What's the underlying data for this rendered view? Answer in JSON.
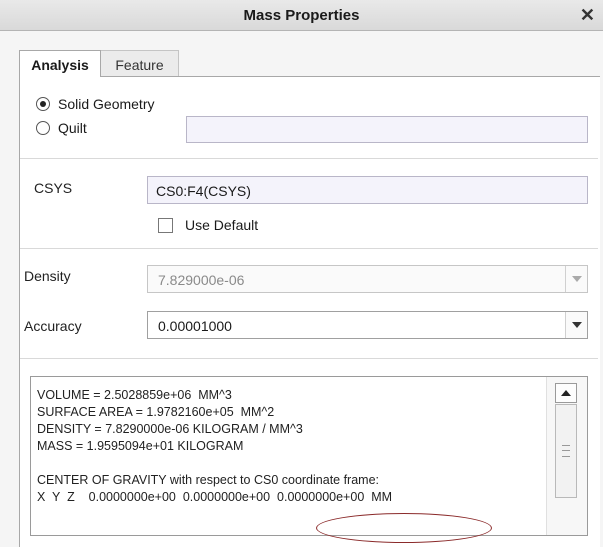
{
  "window": {
    "title": "Mass Properties",
    "close_glyph": "✕"
  },
  "tabs": [
    {
      "label": "Analysis",
      "active": true
    },
    {
      "label": "Feature",
      "active": false
    }
  ],
  "geometry": {
    "options": [
      {
        "label": "Solid Geometry",
        "selected": true
      },
      {
        "label": "Quilt",
        "selected": false
      }
    ],
    "quilt_value": ""
  },
  "csys": {
    "label": "CSYS",
    "value": "CS0:F4(CSYS)",
    "use_default_label": "Use Default",
    "use_default_checked": false
  },
  "density": {
    "label": "Density",
    "value": "7.829000e-06",
    "enabled": false
  },
  "accuracy": {
    "label": "Accuracy",
    "value": "0.00001000"
  },
  "results": {
    "lines": [
      "VOLUME = 2.5028859e+06  MM^3",
      "SURFACE AREA = 1.9782160e+05  MM^2",
      "DENSITY = 7.8290000e-06 KILOGRAM / MM^3",
      "MASS = 1.9595094e+01 KILOGRAM",
      "",
      "CENTER OF GRAVITY with respect to CS0 coordinate frame:",
      "X  Y  Z    0.0000000e+00  0.0000000e+00  0.0000000e+00  MM"
    ]
  },
  "colors": {
    "annotation_ellipse": "#8b2b2b",
    "field_tint": "#f4f3fb"
  },
  "icons": {
    "close": "close-icon",
    "dropdown": "chevron-down-icon",
    "scroll_up": "scroll-up-icon"
  }
}
